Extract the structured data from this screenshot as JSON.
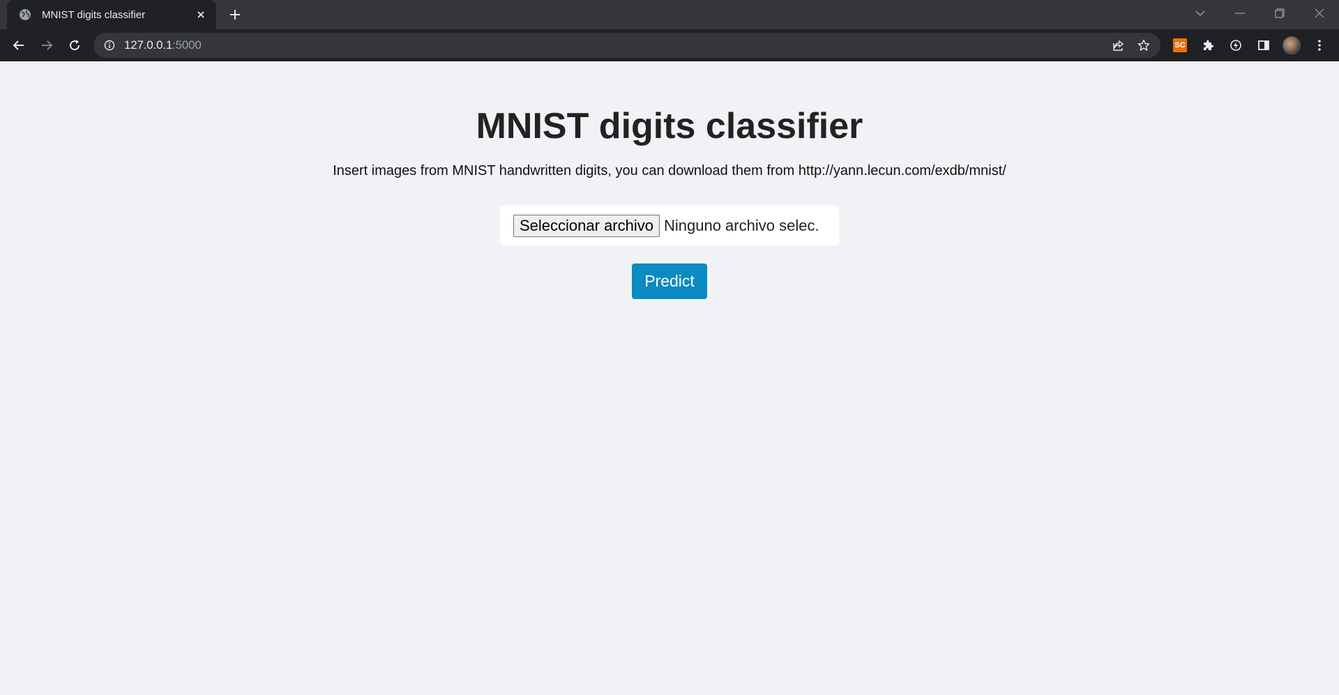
{
  "browser": {
    "tab_title": "MNIST digits classifier",
    "url_host": "127.0.0.1",
    "url_port": ":5000",
    "extension_badge": "SC"
  },
  "page": {
    "title": "MNIST digits classifier",
    "description": "Insert images from MNIST handwritten digits, you can download them from http://yann.lecun.com/exdb/mnist/",
    "file_button_label": "Seleccionar archivo",
    "file_status": "Ninguno archivo selec.",
    "predict_label": "Predict"
  },
  "colors": {
    "page_background": "#f0f2f5",
    "predict_button": "#0a8bc2",
    "chrome_dark": "#202124",
    "tabstrip": "#35363a"
  }
}
